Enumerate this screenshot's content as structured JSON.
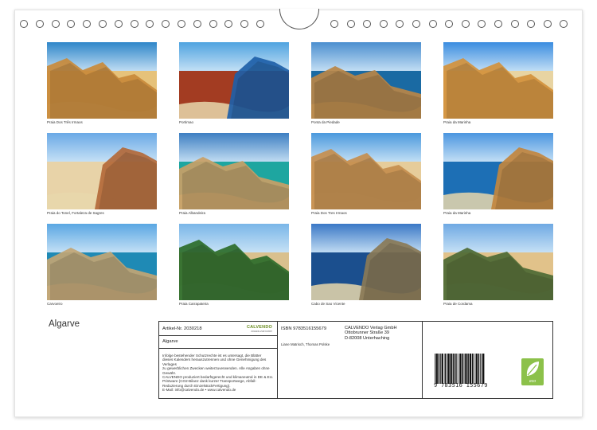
{
  "calendar": {
    "title": "Algarve",
    "ring_count_left": 16,
    "ring_count_right": 15
  },
  "photos": [
    {
      "caption": "Praia Dos Três Irmaos",
      "palette": [
        "#2e86c9",
        "#c98a3a",
        "#e6c27a"
      ]
    },
    {
      "caption": "Portimao",
      "palette": [
        "#4fa3e0",
        "#1e5fa8",
        "#a33c22"
      ]
    },
    {
      "caption": "Ponta da Piedade",
      "palette": [
        "#4b8fcf",
        "#b98546",
        "#1a6aa3"
      ]
    },
    {
      "caption": "Praia da Marinha",
      "palette": [
        "#3a8de0",
        "#d2913c",
        "#e8d4a2"
      ]
    },
    {
      "caption": "Praia do Tonel, Fortaleza de Sagres",
      "palette": [
        "#6aa9e6",
        "#b3693a",
        "#e8d3a8"
      ]
    },
    {
      "caption": "Praia Albandeira",
      "palette": [
        "#3d7fc2",
        "#c9a066",
        "#1ea6a0"
      ]
    },
    {
      "caption": "Praia Dos Tres Irmaos",
      "palette": [
        "#4a99dd",
        "#c68e4e",
        "#e6cc9a"
      ]
    },
    {
      "caption": "Praia da Marinha",
      "palette": [
        "#4b96e0",
        "#c2863e",
        "#1d6fb5"
      ]
    },
    {
      "caption": "Carvoeiro",
      "palette": [
        "#5aa7e3",
        "#c2a574",
        "#1f8ab5"
      ]
    },
    {
      "caption": "Praia Carrapateira",
      "palette": [
        "#7ab6e8",
        "#2d6c2a",
        "#d9c08e"
      ]
    },
    {
      "caption": "Cabo de Sao Vicente",
      "palette": [
        "#3a78c6",
        "#8a7a56",
        "#1b4f8e"
      ]
    },
    {
      "caption": "Praia de Cordama",
      "palette": [
        "#6fa9e3",
        "#4d6a34",
        "#e1c28a"
      ]
    }
  ],
  "info_box": {
    "artikel": "Artikel-Nr. 2030218",
    "brand": "CALVENDO",
    "brand_sub": "ZUGANG ZUR KUNST",
    "calendar_name": "Algarve",
    "legal": [
      "Infolge bestehender Schutzrechte ist es untersagt, die Blätter",
      "dieses Kalenders herauszutrennen und ohne Genehmigung des Verlages",
      "zu gewerblichen Zwecken weiterzuverwenden. Alle Angaben ohne",
      "Gewähr.",
      "CALVENDO produziert bedarfsgerecht und klimaneutral in DE & EU.",
      "Printware (CO2-Bilanz dank kurzer Transportwege, Abfall-",
      "Reduzierung durch EinzelstückFertigung).",
      "E-Mail: info@calvendo.de • www.calvendo.de"
    ],
    "isbn": "ISBN 9783516155679",
    "authors": "Liane Matrisch, Thomas Polske",
    "publisher": [
      "CALVENDO Verlag GmbH",
      "Ottobrunner Straße 39",
      "D-82008 Unterhaching"
    ],
    "ean": "9 783516 155679",
    "eco_label": "eco"
  },
  "colors": {
    "border": "#333333",
    "eco_green": "#8cc14a",
    "brand_green": "#6a8c1f"
  }
}
